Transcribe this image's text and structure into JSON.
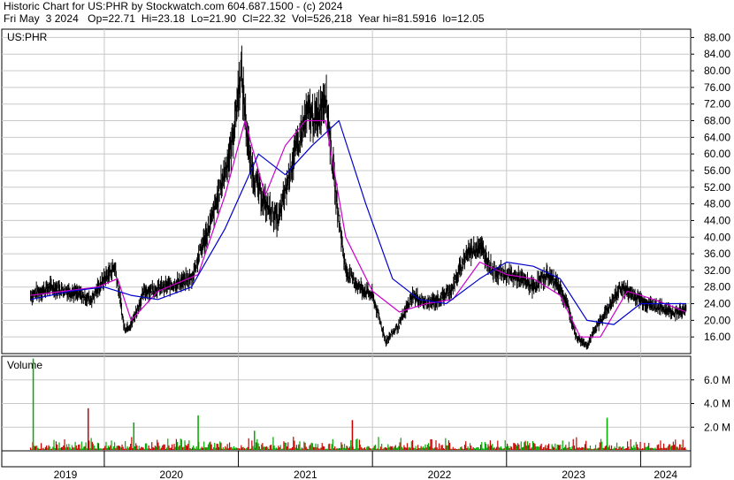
{
  "header": {
    "line1": "Historic Chart for US:PHR by Stockwatch.com 604.687.1500 - (c) 2024",
    "line2": "Fri May  3 2024   Op=22.71  Hi=23.18  Lo=21.90  Cl=22.32  Vol=526,218  Year hi=81.5916  lo=12.05"
  },
  "chart_data": [
    {
      "type": "line",
      "title": "US:PHR",
      "ylim": [
        12,
        90
      ],
      "y_ticks": [
        "88.00",
        "84.00",
        "80.00",
        "76.00",
        "72.00",
        "68.00",
        "64.00",
        "60.00",
        "56.00",
        "52.00",
        "48.00",
        "44.00",
        "40.00",
        "36.00",
        "32.00",
        "28.00",
        "24.00",
        "20.00",
        "16.00"
      ],
      "x_labels": [
        "2019",
        "2020",
        "2021",
        "2022",
        "2023",
        "2024"
      ],
      "x_range": [
        "2019-06",
        "2024-05"
      ],
      "x_unit": "year",
      "grid": true,
      "series": [
        {
          "color": "#000000",
          "x": [
            2019.45,
            2019.6,
            2019.75,
            2019.9,
            2020.0,
            2020.08,
            2020.15,
            2020.2,
            2020.3,
            2020.45,
            2020.55,
            2020.65,
            2020.72,
            2020.8,
            2020.9,
            2020.95,
            2021.02,
            2021.08,
            2021.12,
            2021.2,
            2021.3,
            2021.4,
            2021.48,
            2021.52,
            2021.58,
            2021.65,
            2021.72,
            2021.8,
            2021.9,
            2022.0,
            2022.1,
            2022.2,
            2022.3,
            2022.4,
            2022.5,
            2022.6,
            2022.7,
            2022.8,
            2022.9,
            2023.0,
            2023.1,
            2023.2,
            2023.3,
            2023.38,
            2023.45,
            2023.52,
            2023.6,
            2023.7,
            2023.78,
            2023.85,
            2023.95,
            2024.05,
            2024.15,
            2024.25,
            2024.34
          ],
          "y": [
            26,
            28,
            27,
            25,
            30,
            33,
            18,
            19,
            27,
            28,
            29,
            30,
            37,
            44,
            56,
            62,
            80,
            60,
            54,
            48,
            44,
            58,
            66,
            70,
            68,
            75,
            52,
            32,
            28,
            26,
            15,
            19,
            26,
            24,
            25,
            28,
            36,
            38,
            32,
            31,
            30,
            28,
            31,
            29,
            24,
            16,
            14,
            20,
            24,
            28,
            26,
            24,
            23,
            22,
            22.32
          ]
        },
        {
          "color": "#cc00cc",
          "x": [
            2019.45,
            2019.7,
            2019.95,
            2020.1,
            2020.2,
            2020.4,
            2020.7,
            2020.9,
            2021.05,
            2021.2,
            2021.35,
            2021.5,
            2021.65,
            2021.8,
            2022.0,
            2022.2,
            2022.4,
            2022.6,
            2022.8,
            2023.0,
            2023.2,
            2023.4,
            2023.55,
            2023.7,
            2023.9,
            2024.1,
            2024.34
          ],
          "y": [
            26,
            27,
            28,
            30,
            20,
            27,
            31,
            50,
            68,
            50,
            62,
            68,
            68,
            40,
            27,
            22,
            24,
            25,
            34,
            31,
            30,
            26,
            16,
            16,
            27,
            25,
            22
          ]
        },
        {
          "color": "#0000cc",
          "x": [
            2019.45,
            2019.75,
            2020.0,
            2020.2,
            2020.4,
            2020.65,
            2020.9,
            2021.15,
            2021.35,
            2021.55,
            2021.75,
            2021.95,
            2022.15,
            2022.35,
            2022.55,
            2022.8,
            2023.0,
            2023.2,
            2023.4,
            2023.6,
            2023.8,
            2024.0,
            2024.2,
            2024.34
          ],
          "y": [
            25,
            27,
            28,
            26,
            25,
            28,
            42,
            60,
            55,
            62,
            68,
            48,
            30,
            25,
            24,
            30,
            34,
            33,
            30,
            20,
            19,
            24,
            24,
            24
          ]
        }
      ]
    },
    {
      "type": "bar",
      "title": "Volume",
      "ylim": [
        0,
        8000000
      ],
      "y_ticks": [
        "6.0 M",
        "4.0 M",
        "2.0 M"
      ],
      "colors": {
        "up": "#00aa00",
        "down": "#cc0000"
      },
      "spikes": [
        {
          "x": 2019.47,
          "value": 7800000,
          "dir": "up"
        },
        {
          "x": 2019.88,
          "value": 3600000,
          "dir": "down"
        },
        {
          "x": 2020.22,
          "value": 2400000,
          "dir": "up"
        },
        {
          "x": 2020.7,
          "value": 3000000,
          "dir": "up"
        },
        {
          "x": 2021.12,
          "value": 1700000,
          "dir": "up"
        },
        {
          "x": 2021.85,
          "value": 2600000,
          "dir": "down"
        },
        {
          "x": 2023.75,
          "value": 2800000,
          "dir": "up"
        }
      ]
    }
  ]
}
